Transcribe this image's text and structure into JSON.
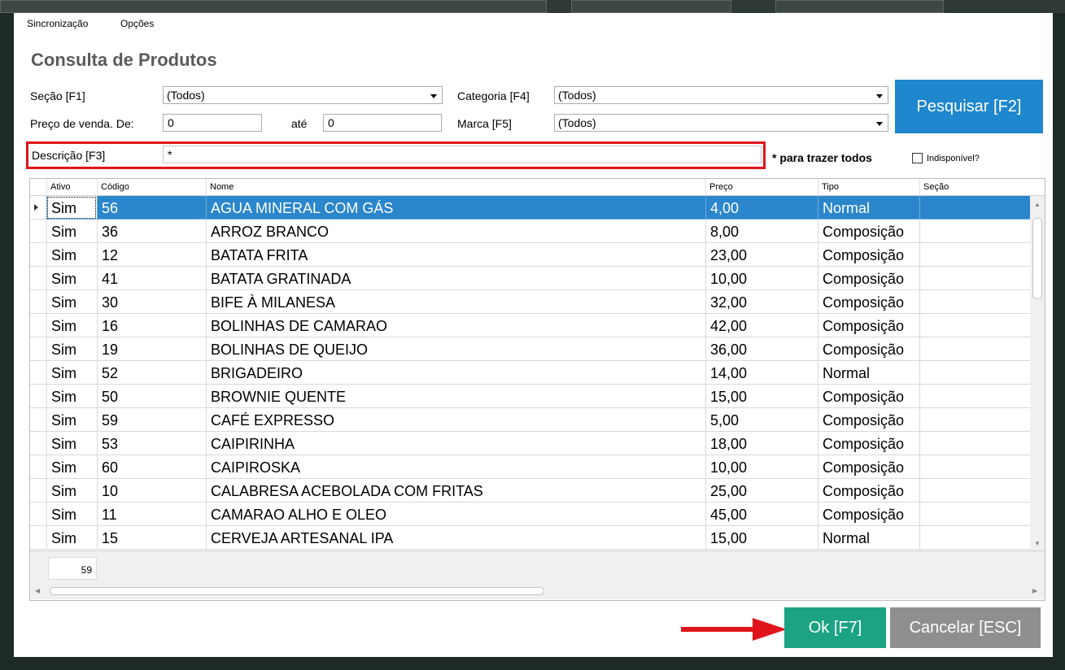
{
  "menu": {
    "items": [
      "Sincronização",
      "Opções"
    ]
  },
  "title": "Consulta de Produtos",
  "filters": {
    "secao_label": "Seção [F1]",
    "secao_value": "(Todos)",
    "categoria_label": "Categoria [F4]",
    "categoria_value": "(Todos)",
    "preco_label": "Preço de venda. De:",
    "preco_de": "0",
    "ate_label": "até",
    "preco_ate": "0",
    "marca_label": "Marca [F5]",
    "marca_value": "(Todos)",
    "search_button": "Pesquisar [F2]",
    "descricao_label": "Descrição [F3]",
    "descricao_value": "*",
    "hint": "* para trazer todos",
    "indisponivel_label": "Indisponível?",
    "indisponivel_checked": false
  },
  "grid": {
    "columns": [
      "Ativo",
      "Código",
      "Nome",
      "Preço",
      "Tipo",
      "Seção"
    ],
    "rows": [
      [
        "Sim",
        "56",
        "AGUA MINERAL COM GÁS",
        "4,00",
        "Normal",
        ""
      ],
      [
        "Sim",
        "36",
        "ARROZ BRANCO",
        "8,00",
        "Composição",
        ""
      ],
      [
        "Sim",
        "12",
        "BATATA FRITA",
        "23,00",
        "Composição",
        ""
      ],
      [
        "Sim",
        "41",
        "BATATA GRATINADA",
        "10,00",
        "Composição",
        ""
      ],
      [
        "Sim",
        "30",
        "BIFE À MILANESA",
        "32,00",
        "Composição",
        ""
      ],
      [
        "Sim",
        "16",
        "BOLINHAS DE CAMARAO",
        "42,00",
        "Composição",
        ""
      ],
      [
        "Sim",
        "19",
        "BOLINHAS DE QUEIJO",
        "36,00",
        "Composição",
        ""
      ],
      [
        "Sim",
        "52",
        "BRIGADEIRO",
        "14,00",
        "Normal",
        ""
      ],
      [
        "Sim",
        "50",
        "BROWNIE QUENTE",
        "15,00",
        "Composição",
        ""
      ],
      [
        "Sim",
        "59",
        "CAFÉ EXPRESSO",
        "5,00",
        "Composição",
        ""
      ],
      [
        "Sim",
        "53",
        "CAIPIRINHA",
        "18,00",
        "Composição",
        ""
      ],
      [
        "Sim",
        "60",
        "CAIPIROSKA",
        "10,00",
        "Composição",
        ""
      ],
      [
        "Sim",
        "10",
        "CALABRESA ACEBOLADA COM FRITAS",
        "25,00",
        "Composição",
        ""
      ],
      [
        "Sim",
        "11",
        "CAMARAO ALHO E OLEO",
        "45,00",
        "Composição",
        ""
      ],
      [
        "Sim",
        "15",
        "CERVEJA ARTESANAL IPA",
        "15,00",
        "Normal",
        ""
      ]
    ],
    "selected_row": 0,
    "count": "59"
  },
  "actions": {
    "ok": "Ok [F7]",
    "cancel": "Cancelar [ESC]"
  },
  "colors": {
    "search_blue": "#1e87cd",
    "ok_green": "#1ba383",
    "cancel_gray": "#8f8f8f",
    "highlight_red": "#e0141b",
    "selection_blue": "#2b86cc"
  }
}
